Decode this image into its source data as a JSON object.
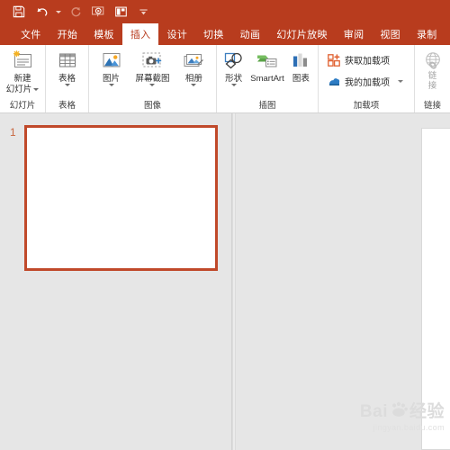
{
  "quick_access": {
    "buttons": [
      {
        "name": "save-button",
        "icon": "save-icon",
        "label": "保存"
      },
      {
        "name": "undo-button",
        "icon": "undo-icon",
        "label": "撤消"
      },
      {
        "name": "redo-button",
        "icon": "redo-icon",
        "label": "恢复"
      },
      {
        "name": "start-slideshow-button",
        "icon": "slideshow-icon",
        "label": "从头开始"
      },
      {
        "name": "layout-button",
        "icon": "layout-icon",
        "label": "版式"
      },
      {
        "name": "customize-qat-button",
        "icon": "chevron-down-icon",
        "label": "自定义快速访问工具栏"
      }
    ]
  },
  "tabs": [
    {
      "label": "文件",
      "active": false
    },
    {
      "label": "开始",
      "active": false
    },
    {
      "label": "模板",
      "active": false
    },
    {
      "label": "插入",
      "active": true
    },
    {
      "label": "设计",
      "active": false
    },
    {
      "label": "切换",
      "active": false
    },
    {
      "label": "动画",
      "active": false
    },
    {
      "label": "幻灯片放映",
      "active": false
    },
    {
      "label": "审阅",
      "active": false
    },
    {
      "label": "视图",
      "active": false
    },
    {
      "label": "录制",
      "active": false
    }
  ],
  "ribbon": {
    "groups": [
      {
        "label": "幻灯片",
        "items": [
          {
            "name": "new-slide-button",
            "icon": "new-slide-icon",
            "label_line1": "新建",
            "label_line2": "幻灯片",
            "has_dropdown": true
          }
        ]
      },
      {
        "label": "表格",
        "items": [
          {
            "name": "table-button",
            "icon": "table-icon",
            "label_line1": "表格",
            "label_line2": "",
            "has_dropdown": true
          }
        ]
      },
      {
        "label": "图像",
        "items": [
          {
            "name": "picture-button",
            "icon": "picture-icon",
            "label_line1": "图片",
            "label_line2": "",
            "has_dropdown": true
          },
          {
            "name": "screenshot-button",
            "icon": "screenshot-icon",
            "label_line1": "屏幕截图",
            "label_line2": "",
            "has_dropdown": true
          },
          {
            "name": "photo-album-button",
            "icon": "photo-album-icon",
            "label_line1": "相册",
            "label_line2": "",
            "has_dropdown": true
          }
        ]
      },
      {
        "label": "插图",
        "items": [
          {
            "name": "shapes-button",
            "icon": "shapes-icon",
            "label_line1": "形状",
            "label_line2": "",
            "has_dropdown": true
          },
          {
            "name": "smartart-button",
            "icon": "smartart-icon",
            "label_line1": "SmartArt",
            "label_line2": "",
            "has_dropdown": false
          },
          {
            "name": "chart-button",
            "icon": "chart-icon",
            "label_line1": "图表",
            "label_line2": "",
            "has_dropdown": false
          }
        ]
      },
      {
        "label": "加载项",
        "items": [
          {
            "name": "get-addins-button",
            "icon": "store-icon",
            "label_line1": "获取加载项",
            "label_line2": "",
            "has_dropdown": false
          },
          {
            "name": "my-addins-button",
            "icon": "my-addins-icon",
            "label_line1": "我的加载项",
            "label_line2": "",
            "has_dropdown": true
          }
        ]
      },
      {
        "label": "链接",
        "items": [
          {
            "name": "link-button",
            "icon": "globe-link-icon",
            "label_line1": "链",
            "label_line2": "接",
            "has_dropdown": false
          }
        ]
      }
    ]
  },
  "thumbnail_pane": {
    "slides": [
      {
        "number": "1",
        "selected": true
      }
    ]
  },
  "watermark": {
    "brand_left": "Bai",
    "brand_right": "经验",
    "url": "jingyan.baidu.com"
  },
  "colors": {
    "accent": "#b83c1e",
    "slide_selected_border": "#c0492a",
    "workspace_bg": "#e6e6e6",
    "ribbon_bg": "#ffffff"
  }
}
